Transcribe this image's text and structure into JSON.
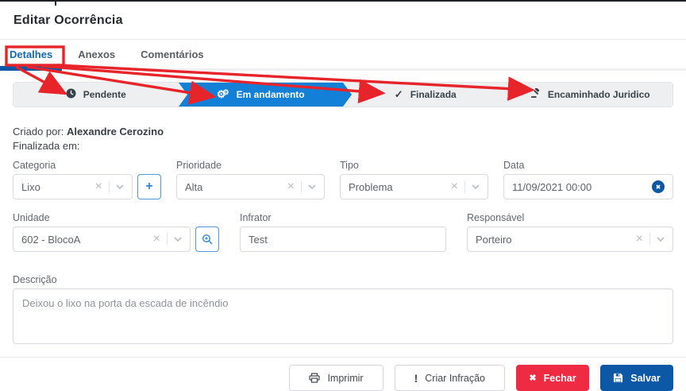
{
  "window": {
    "title": "Editar Ocorrência"
  },
  "tabs": {
    "detalhes": "Detalhes",
    "anexos": "Anexos",
    "comentarios": "Comentários"
  },
  "stepper": {
    "pendente": "Pendente",
    "em_andamento": "Em andamento",
    "finalizada": "Finalizada",
    "encaminhado": "Encaminhado Juridico"
  },
  "meta": {
    "created_by_label": "Criado por:",
    "created_by_value": "Alexandre Cerozino",
    "finished_at_label": "Finalizada em:"
  },
  "fields": {
    "categoria": {
      "label": "Categoria",
      "value": "Lixo"
    },
    "prioridade": {
      "label": "Prioridade",
      "value": "Alta"
    },
    "tipo": {
      "label": "Tipo",
      "value": "Problema"
    },
    "data": {
      "label": "Data",
      "value": "11/09/2021 00:00"
    },
    "unidade": {
      "label": "Unidade",
      "value": "602 - BlocoA"
    },
    "infrator": {
      "label": "Infrator",
      "value": "Test"
    },
    "responsavel": {
      "label": "Responsável",
      "value": "Porteiro"
    },
    "descricao": {
      "label": "Descrição",
      "value": "Deixou o lixo na porta da escada de incêndio"
    }
  },
  "buttons": {
    "imprimir": "Imprimir",
    "criar_infracao": "Criar Infração",
    "fechar": "Fechar",
    "salvar": "Salvar"
  },
  "icons": {
    "clear_x": "×",
    "close_x": "✖",
    "check": "✓",
    "gear": "⚙",
    "plus": "+",
    "exclamation": "!"
  },
  "colors": {
    "step_active_blue": "#1180d6",
    "save_blue": "#0c57a6",
    "close_red": "#ee2b43",
    "tab_active_blue": "#1467b2",
    "annotation_red": "#e8242b",
    "step_gray": "#edeff1"
  }
}
